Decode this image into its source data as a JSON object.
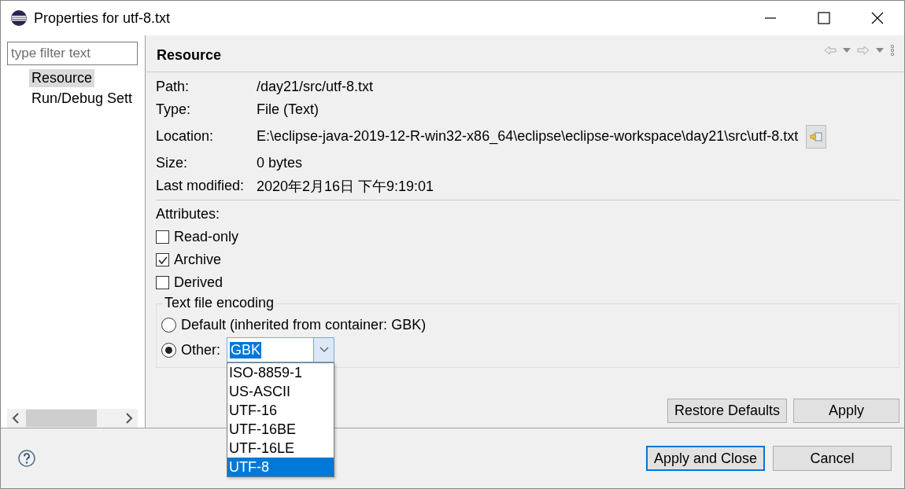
{
  "window": {
    "title": "Properties for utf-8.txt"
  },
  "filter": {
    "placeholder": "type filter text"
  },
  "tree": [
    {
      "label": "Resource",
      "selected": true
    },
    {
      "label": "Run/Debug Sett",
      "selected": false
    }
  ],
  "page": {
    "title": "Resource",
    "properties": [
      {
        "label": "Path:",
        "value": "/day21/src/utf-8.txt"
      },
      {
        "label": "Type:",
        "value": "File  (Text)"
      },
      {
        "label": "Location:",
        "value": "E:\\eclipse-java-2019-12-R-win32-x86_64\\eclipse\\eclipse-workspace\\day21\\src\\utf-8.txt",
        "kind": "path"
      },
      {
        "label": "Size:",
        "value": "0  bytes"
      },
      {
        "label": "Last modified:",
        "value": "2020年2月16日 下午9:19:01"
      }
    ],
    "attributes_label": "Attributes:",
    "attributes": [
      {
        "label": "Read-only",
        "checked": false
      },
      {
        "label": "Archive",
        "checked": true
      },
      {
        "label": "Derived",
        "checked": false
      }
    ],
    "encoding": {
      "title": "Text file encoding",
      "options": [
        {
          "label": "Default (inherited from container: GBK)",
          "selected": false
        },
        {
          "label": "Other:",
          "selected": true
        }
      ],
      "value": "GBK",
      "dropdown": [
        {
          "label": "ISO-8859-1",
          "selected": false
        },
        {
          "label": "US-ASCII",
          "selected": false
        },
        {
          "label": "UTF-16",
          "selected": false
        },
        {
          "label": "UTF-16BE",
          "selected": false
        },
        {
          "label": "UTF-16LE",
          "selected": false
        },
        {
          "label": "UTF-8",
          "selected": true
        }
      ]
    },
    "buttons": [
      "Restore Defaults",
      "Apply"
    ]
  },
  "footer_buttons": [
    {
      "label": "Apply and Close",
      "default": true
    },
    {
      "label": "Cancel",
      "default": false
    }
  ]
}
